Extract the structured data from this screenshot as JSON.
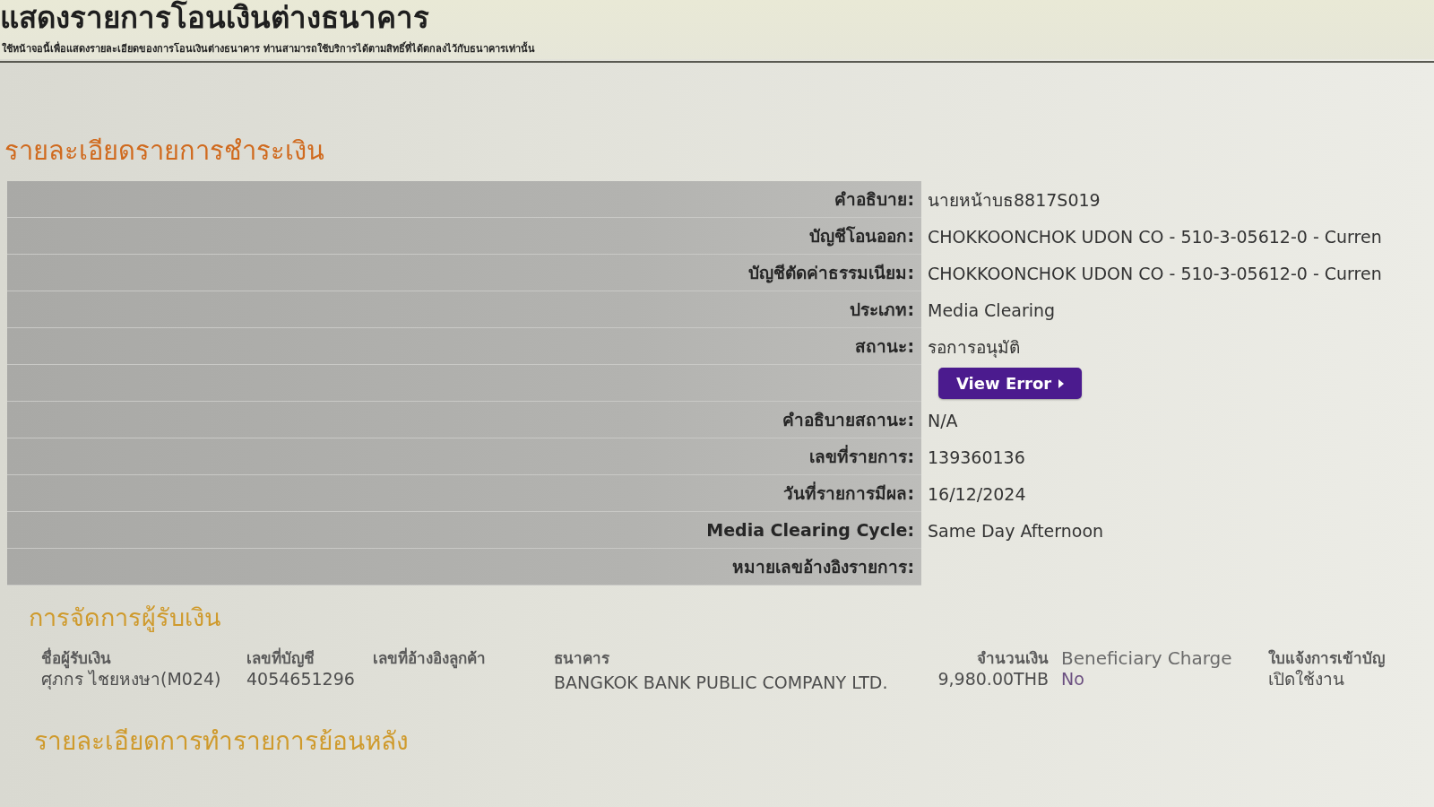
{
  "page": {
    "title": "แสดงรายการโอนเงินต่างธนาคาร",
    "subtitle": "ใช้หน้าจอนี้เพื่อแสดงรายละเอียดของการโอนเงินต่างธนาคาร ท่านสามารถใช้บริการได้ตามสิทธิ์ที่ได้ตกลงไว้กับธนาคารเท่านั้น"
  },
  "payment_details": {
    "heading": "รายละเอียดรายการชำระเงิน",
    "rows": [
      {
        "kind": "field",
        "label": "คำอธิบาย:",
        "value": "นายหน้าบธ8817S019"
      },
      {
        "kind": "field",
        "label": "บัญชีโอนออก:",
        "value": "CHOKKOONCHOK UDON CO - 510-3-05612-0 - Curren"
      },
      {
        "kind": "field",
        "label": "บัญชีตัดค่าธรรมเนียม:",
        "value": "CHOKKOONCHOK UDON CO - 510-3-05612-0 - Curren"
      },
      {
        "kind": "field",
        "label": "ประเภท:",
        "value": "Media Clearing"
      },
      {
        "kind": "field",
        "label": "สถานะ:",
        "value": "รอการอนุมัติ"
      },
      {
        "kind": "button",
        "label": "View Error"
      },
      {
        "kind": "field",
        "label": "คำอธิบายสถานะ:",
        "value": "N/A"
      },
      {
        "kind": "field",
        "label": "เลขที่รายการ:",
        "value": "139360136"
      },
      {
        "kind": "field",
        "label": "วันที่รายการมีผล:",
        "value": "16/12/2024"
      },
      {
        "kind": "field",
        "label": "Media Clearing Cycle:",
        "value": "Same Day Afternoon"
      },
      {
        "kind": "field",
        "label": "หมายเลขอ้างอิงรายการ:"
      }
    ]
  },
  "payee_management": {
    "heading": "การจัดการผู้รับเงิน",
    "columns": [
      "ชื่อผู้รับเงิน",
      "เลขที่บัญชี",
      "เลขที่อ้างอิงลูกค้า",
      "ธนาคาร",
      "จำนวนเงิน",
      "Beneficiary Charge",
      "ใบแจ้งการเข้าบัญ"
    ],
    "rows": [
      {
        "payee_name": "ศุภกร ไชยหงษา(M024)",
        "account_number": "4054651296",
        "bank": "BANGKOK BANK PUBLIC COMPANY LTD.",
        "amount": "9,980.00THB",
        "beneficiary_charge": "No",
        "column_7": "เปิดใช้งาน"
      }
    ]
  },
  "history": {
    "heading": "รายละเอียดการทำรายการย้อนหลัง"
  }
}
